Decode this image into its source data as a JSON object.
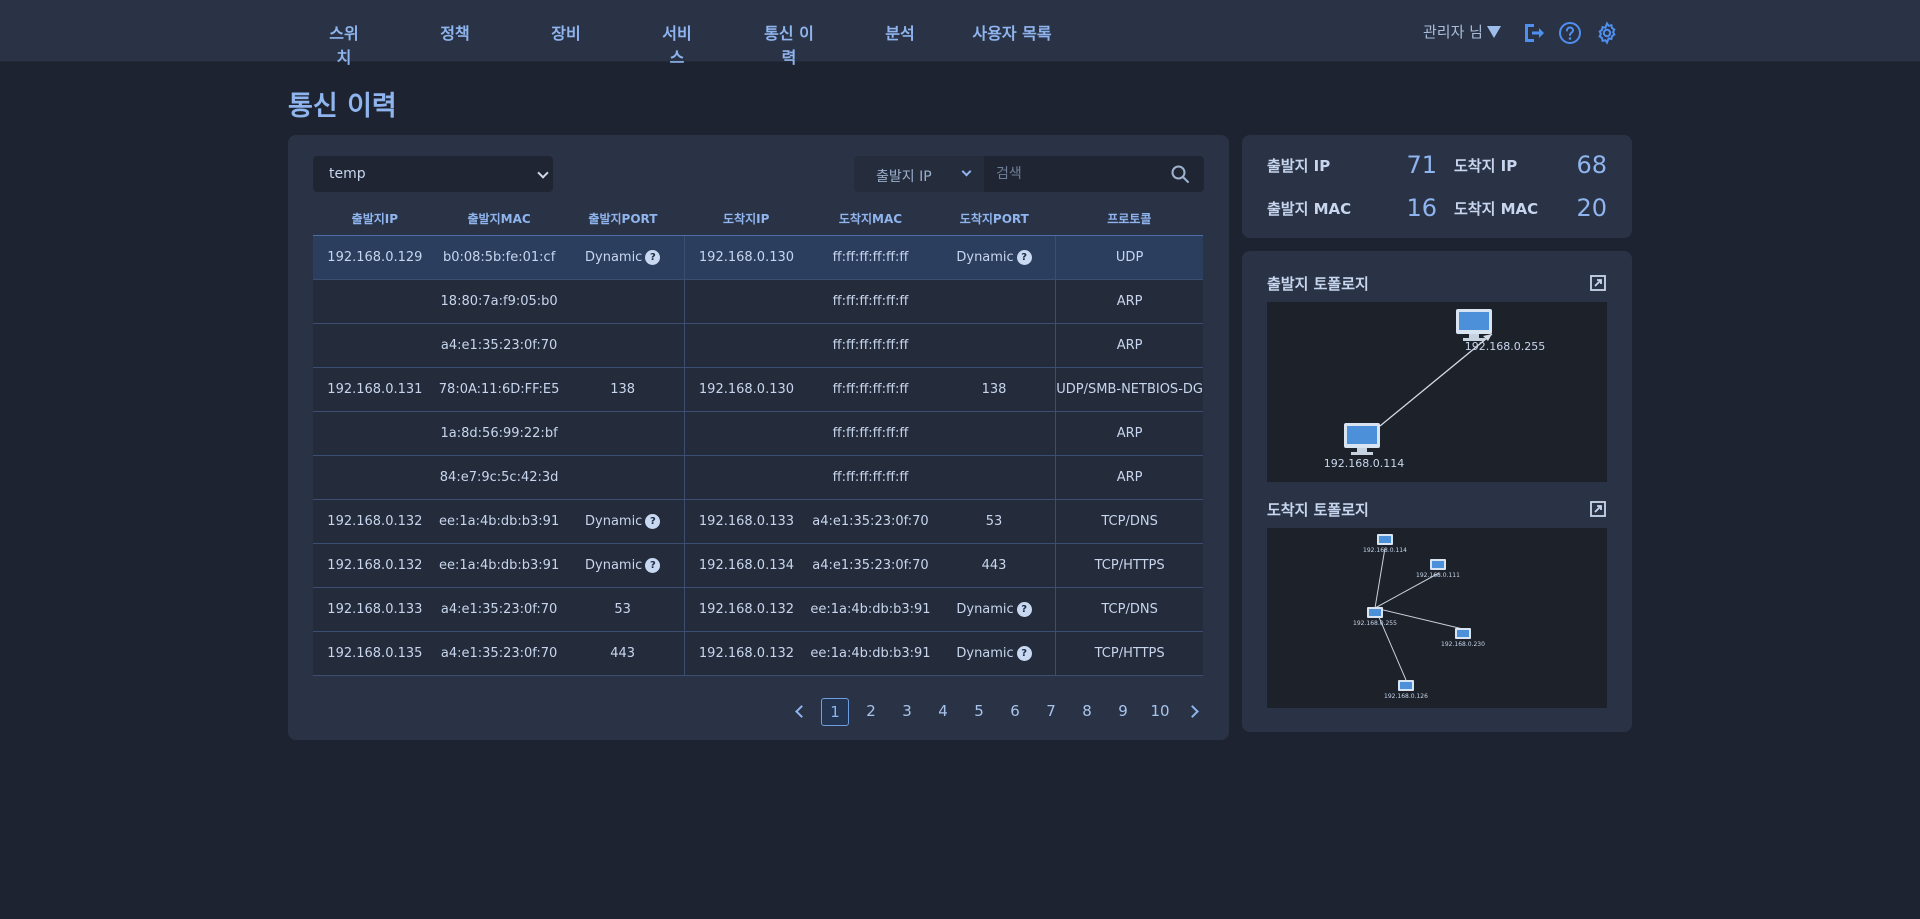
{
  "nav": {
    "items": [
      "스위치",
      "정책",
      "장비",
      "서비스",
      "통신 이력",
      "분석",
      "사용자 목록"
    ],
    "user_label": "관리자 님",
    "icons": [
      "logout-icon",
      "help-icon",
      "settings-icon"
    ]
  },
  "page": {
    "title": "통신 이력"
  },
  "filter": {
    "group_select": "temp",
    "search_type": "출발지 IP",
    "search_placeholder": "검색"
  },
  "table": {
    "headers": [
      "출발지IP",
      "출발지MAC",
      "출발지PORT",
      "도착지IP",
      "도착지MAC",
      "도착지PORT",
      "프로토콜"
    ],
    "rows": [
      [
        "192.168.0.129",
        "b0:08:5b:fe:01:cf",
        "Dynamic",
        "192.168.0.130",
        "ff:ff:ff:ff:ff:ff",
        "Dynamic",
        "UDP"
      ],
      [
        "",
        "18:80:7a:f9:05:b0",
        "",
        "",
        "ff:ff:ff:ff:ff:ff",
        "",
        "ARP"
      ],
      [
        "",
        "a4:e1:35:23:0f:70",
        "",
        "",
        "ff:ff:ff:ff:ff:ff",
        "",
        "ARP"
      ],
      [
        "192.168.0.131",
        "78:0A:11:6D:FF:E5",
        "138",
        "192.168.0.130",
        "ff:ff:ff:ff:ff:ff",
        "138",
        "UDP/SMB-NETBIOS-DG"
      ],
      [
        "",
        "1a:8d:56:99:22:bf",
        "",
        "",
        "ff:ff:ff:ff:ff:ff",
        "",
        "ARP"
      ],
      [
        "",
        "84:e7:9c:5c:42:3d",
        "",
        "",
        "ff:ff:ff:ff:ff:ff",
        "",
        "ARP"
      ],
      [
        "192.168.0.132",
        "ee:1a:4b:db:b3:91",
        "Dynamic",
        "192.168.0.133",
        "a4:e1:35:23:0f:70",
        "53",
        "TCP/DNS"
      ],
      [
        "192.168.0.132",
        "ee:1a:4b:db:b3:91",
        "Dynamic",
        "192.168.0.134",
        "a4:e1:35:23:0f:70",
        "443",
        "TCP/HTTPS"
      ],
      [
        "192.168.0.133",
        "a4:e1:35:23:0f:70",
        "53",
        "192.168.0.132",
        "ee:1a:4b:db:b3:91",
        "Dynamic",
        "TCP/DNS"
      ],
      [
        "192.168.0.135",
        "a4:e1:35:23:0f:70",
        "443",
        "192.168.0.132",
        "ee:1a:4b:db:b3:91",
        "Dynamic",
        "TCP/HTTPS"
      ]
    ],
    "help_mark": "?"
  },
  "pagination": {
    "pages": [
      "1",
      "2",
      "3",
      "4",
      "5",
      "6",
      "7",
      "8",
      "9",
      "10"
    ],
    "current": "1"
  },
  "stats": {
    "src_ip_label": "출발지 IP",
    "src_ip_value": "71",
    "dst_ip_label": "도착지 IP",
    "dst_ip_value": "68",
    "src_mac_label": "출발지 MAC",
    "src_mac_value": "16",
    "dst_mac_label": "도착지 MAC",
    "dst_mac_value": "20"
  },
  "topology": {
    "source": {
      "title": "출발지 토폴로지",
      "nodes": [
        "192.168.0.255",
        "192.168.0.114"
      ]
    },
    "destination": {
      "title": "도착지 토폴로지",
      "nodes": [
        "192.168.0.114",
        "192.168.0.111",
        "192.168.0.255",
        "192.168.0.230",
        "192.168.0.126"
      ]
    }
  },
  "colors": {
    "background": "#1d2330",
    "card": "#2a3346",
    "accent": "#8fb4ee",
    "selected_row": "#2b3e5e"
  }
}
